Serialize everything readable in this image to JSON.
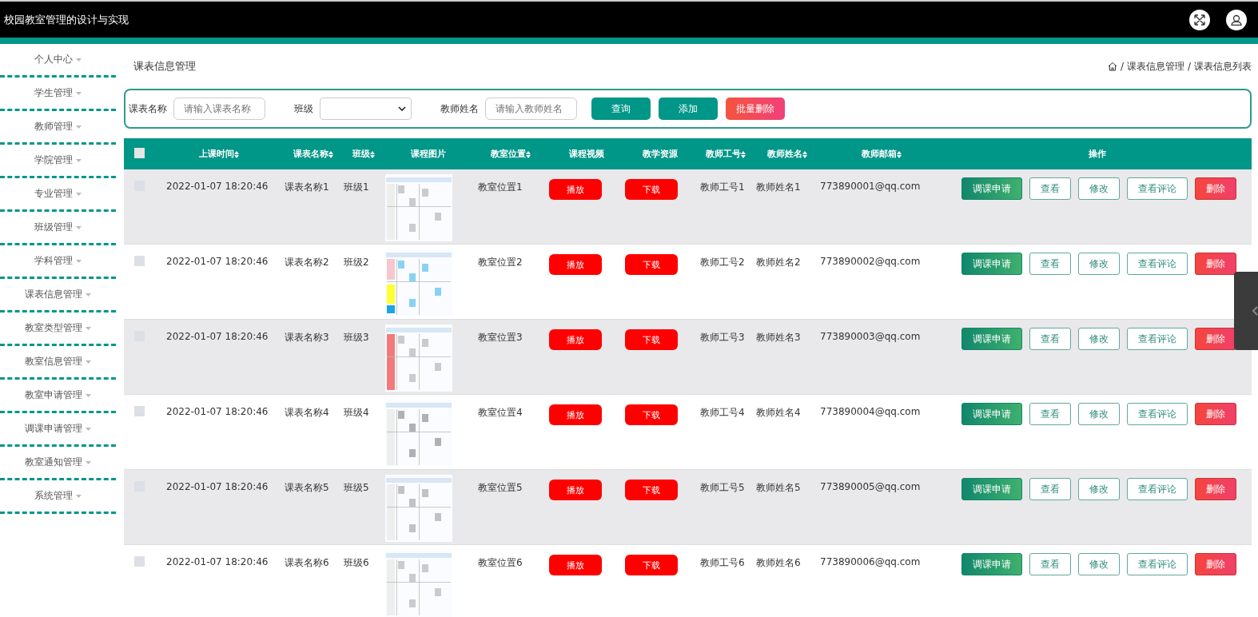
{
  "header": {
    "title": "校园教室管理的设计与实现"
  },
  "sidebar": {
    "items": [
      {
        "label": "个人中心"
      },
      {
        "label": "学生管理"
      },
      {
        "label": "教师管理"
      },
      {
        "label": "学院管理"
      },
      {
        "label": "专业管理"
      },
      {
        "label": "班级管理"
      },
      {
        "label": "学科管理"
      },
      {
        "label": "课表信息管理"
      },
      {
        "label": "教室类型管理"
      },
      {
        "label": "教室信息管理"
      },
      {
        "label": "教室申请管理"
      },
      {
        "label": "调课申请管理"
      },
      {
        "label": "教室通知管理"
      },
      {
        "label": "系统管理"
      }
    ]
  },
  "page_title": "课表信息管理",
  "breadcrumb": [
    "/",
    "课表信息管理",
    "/",
    "课表信息列表"
  ],
  "search": {
    "fields": [
      {
        "kind": "input",
        "label": "课表名称",
        "placeholder": "请输入课表名称"
      },
      {
        "kind": "select",
        "label": "班级"
      },
      {
        "kind": "input",
        "label": "教师姓名",
        "placeholder": "请输入教师姓名"
      }
    ],
    "buttons": [
      {
        "label": "查询",
        "kind": "primary"
      },
      {
        "label": "添加",
        "kind": "primary"
      },
      {
        "label": "批量删除",
        "kind": "danger"
      }
    ]
  },
  "table": {
    "select_all": {
      "checked": false
    },
    "columns": [
      {
        "label": "上课时间",
        "sortable": true
      },
      {
        "label": "课表名称",
        "sortable": true
      },
      {
        "label": "班级",
        "sortable": true
      },
      {
        "label": "课程图片",
        "sortable": false
      },
      {
        "label": "教室位置",
        "sortable": true
      },
      {
        "label": "课程视频",
        "sortable": false
      },
      {
        "label": "教学资源",
        "sortable": false
      },
      {
        "label": "教师工号",
        "sortable": true
      },
      {
        "label": "教师姓名",
        "sortable": true
      },
      {
        "label": "教师邮箱",
        "sortable": true
      },
      {
        "label": "操作",
        "sortable": false
      }
    ],
    "rows": [
      {
        "checked": false,
        "time": "2022-01-07 18:20:46",
        "name": "课表名称1",
        "class": "班级1",
        "picture": {
          "kind": "picture"
        },
        "location": "教室位置1",
        "video": "播放",
        "resource": "下载",
        "teacher_no": "教师工号1",
        "teacher_name": "教师姓名1",
        "email": "773890001@qq.com",
        "actions": [
          "调课申请",
          "查看",
          "修改",
          "查看评论",
          "删除"
        ]
      },
      {
        "checked": false,
        "time": "2022-01-07 18:20:46",
        "name": "课表名称2",
        "class": "班级2",
        "picture": {
          "kind": "picture"
        },
        "location": "教室位置2",
        "video": "播放",
        "resource": "下载",
        "teacher_no": "教师工号2",
        "teacher_name": "教师姓名2",
        "email": "773890002@qq.com",
        "actions": [
          "调课申请",
          "查看",
          "修改",
          "查看评论",
          "删除"
        ]
      },
      {
        "checked": false,
        "time": "2022-01-07 18:20:46",
        "name": "课表名称3",
        "class": "班级3",
        "picture": {
          "kind": "picture"
        },
        "location": "教室位置3",
        "video": "播放",
        "resource": "下载",
        "teacher_no": "教师工号3",
        "teacher_name": "教师姓名3",
        "email": "773890003@qq.com",
        "actions": [
          "调课申请",
          "查看",
          "修改",
          "查看评论",
          "删除"
        ]
      },
      {
        "checked": false,
        "time": "2022-01-07 18:20:46",
        "name": "课表名称4",
        "class": "班级4",
        "picture": {
          "kind": "picture"
        },
        "location": "教室位置4",
        "video": "播放",
        "resource": "下载",
        "teacher_no": "教师工号4",
        "teacher_name": "教师姓名4",
        "email": "773890004@qq.com",
        "actions": [
          "调课申请",
          "查看",
          "修改",
          "查看评论",
          "删除"
        ]
      },
      {
        "checked": false,
        "time": "2022-01-07 18:20:46",
        "name": "课表名称5",
        "class": "班级5",
        "picture": {
          "kind": "picture"
        },
        "location": "教室位置5",
        "video": "播放",
        "resource": "下载",
        "teacher_no": "教师工号5",
        "teacher_name": "教师姓名5",
        "email": "773890005@qq.com",
        "actions": [
          "调课申请",
          "查看",
          "修改",
          "查看评论",
          "删除"
        ]
      },
      {
        "checked": false,
        "time": "2022-01-07 18:20:46",
        "name": "课表名称6",
        "class": "班级6",
        "picture": {
          "kind": "picture"
        },
        "location": "教室位置6",
        "video": "播放",
        "resource": "下载",
        "teacher_no": "教师工号6",
        "teacher_name": "教师姓名6",
        "email": "773890006@qq.com",
        "actions": [
          "调课申请",
          "查看",
          "修改",
          "查看评论",
          "删除"
        ]
      }
    ]
  }
}
